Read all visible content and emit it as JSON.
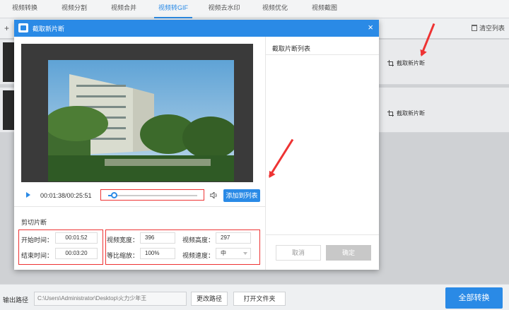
{
  "nav": {
    "tabs": [
      {
        "label": "视频转换"
      },
      {
        "label": "视频分割"
      },
      {
        "label": "视频合并"
      },
      {
        "label": "视频转GIF"
      },
      {
        "label": "视频去水印"
      },
      {
        "label": "视频优化"
      },
      {
        "label": "视频截图"
      }
    ],
    "active_index": 3
  },
  "main": {
    "add_symbol": "+",
    "clear_label": "清空列表",
    "rows": [
      {
        "cut_label": "截取新片断"
      },
      {
        "cut_label": "截取新片断"
      }
    ]
  },
  "dialog": {
    "title": "截取新片断",
    "close_symbol": "×",
    "player": {
      "time_display": "00:01:38/00:25:51",
      "progress": 0.063,
      "add_to_list_label": "添加到列表"
    },
    "section_title": "剪切片断",
    "fields": {
      "start_label": "开始时间：",
      "start_value": "00:01:52",
      "end_label": "结束时间：",
      "end_value": "00:03:20",
      "width_label": "视频宽度：",
      "width_value": "396",
      "height_label": "视频高度：",
      "height_value": "297",
      "scale_label": "等比缩放：",
      "scale_value": "100%",
      "speed_label": "视频速度：",
      "speed_value": "中"
    },
    "list_title": "截取片断列表",
    "cancel_label": "取消",
    "ok_label": "确定"
  },
  "bottom": {
    "output_label": "输出路径",
    "output_path": "C:\\Users\\Administrator\\Desktop\\火力少年王",
    "change_path_label": "更改路径",
    "open_folder_label": "打开文件夹",
    "convert_all_label": "全部转换"
  },
  "colors": {
    "accent": "#2a8ae6",
    "annotation_red": "#e33333"
  }
}
